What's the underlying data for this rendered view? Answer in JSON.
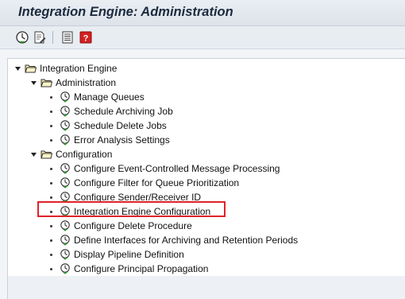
{
  "window": {
    "title": "Integration Engine: Administration"
  },
  "toolbar": {
    "buttons": [
      {
        "icon": "execute-clock-icon"
      },
      {
        "icon": "edit-document-icon"
      },
      {
        "icon": "list-icon"
      },
      {
        "icon": "help-icon"
      }
    ]
  },
  "tree": {
    "root": {
      "label": "Integration Engine",
      "expanded": true,
      "groups": [
        {
          "label": "Administration",
          "expanded": true,
          "items": [
            {
              "label": "Manage Queues"
            },
            {
              "label": "Schedule Archiving Job"
            },
            {
              "label": "Schedule Delete Jobs"
            },
            {
              "label": "Error Analysis Settings"
            }
          ]
        },
        {
          "label": "Configuration",
          "expanded": true,
          "items": [
            {
              "label": "Configure Event-Controlled Message Processing"
            },
            {
              "label": "Configure Filter for Queue Prioritization"
            },
            {
              "label": "Configure Sender/Receiver ID"
            },
            {
              "label": "Integration Engine Configuration",
              "highlighted": true
            },
            {
              "label": "Configure Delete Procedure"
            },
            {
              "label": "Define Interfaces for Archiving and Retention Periods"
            },
            {
              "label": "Display Pipeline Definition"
            },
            {
              "label": "Configure Principal Propagation"
            }
          ]
        }
      ]
    }
  },
  "colors": {
    "highlight_border": "#e0222a",
    "folder_fill": "#fbe9a7",
    "clock_green": "#2e8a2e"
  }
}
